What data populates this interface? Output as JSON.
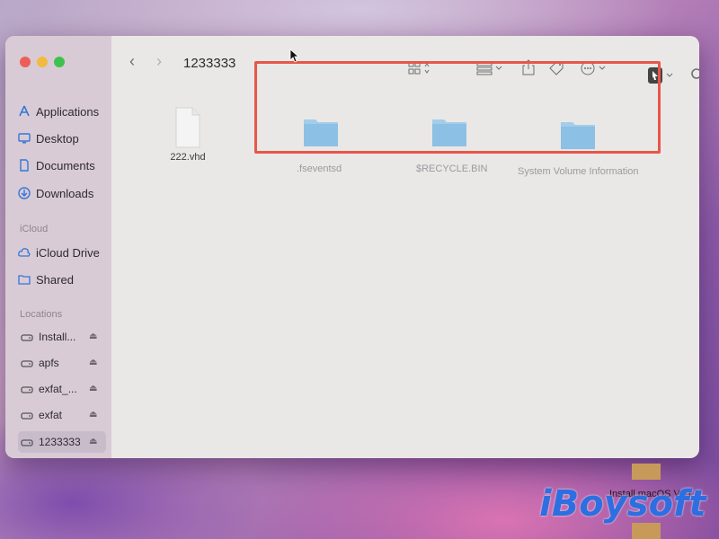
{
  "window": {
    "path_title": "1233333"
  },
  "sidebar": {
    "favorites": [
      {
        "label": "Applications",
        "icon": "applications-icon"
      },
      {
        "label": "Desktop",
        "icon": "desktop-icon"
      },
      {
        "label": "Documents",
        "icon": "document-icon"
      },
      {
        "label": "Downloads",
        "icon": "downloads-icon"
      }
    ],
    "icloud_header": "iCloud",
    "icloud": [
      {
        "label": "iCloud Drive",
        "icon": "cloud-icon"
      },
      {
        "label": "Shared",
        "icon": "shared-folder-icon"
      }
    ],
    "locations_header": "Locations",
    "locations": [
      {
        "label": "Install...",
        "icon": "drive-icon"
      },
      {
        "label": "apfs",
        "icon": "drive-icon"
      },
      {
        "label": "exfat_...",
        "icon": "drive-icon"
      },
      {
        "label": "exfat",
        "icon": "drive-icon"
      },
      {
        "label": "1233333",
        "icon": "drive-icon",
        "selected": true
      }
    ]
  },
  "files": [
    {
      "name": "222.vhd",
      "type": "document"
    },
    {
      "name": ".fseventsd",
      "type": "folder",
      "hidden": true
    },
    {
      "name": "$RECYCLE.BIN",
      "type": "folder",
      "hidden": true
    },
    {
      "name": "System Volume Information",
      "type": "folder",
      "hidden": true
    }
  ],
  "desktop": {
    "install_label": "Install macOS Ven",
    "watermark": "iBoysoft"
  },
  "colors": {
    "highlight": "#e8564a",
    "folder": "#7fb8df",
    "watermark": "#2d6fe0"
  }
}
